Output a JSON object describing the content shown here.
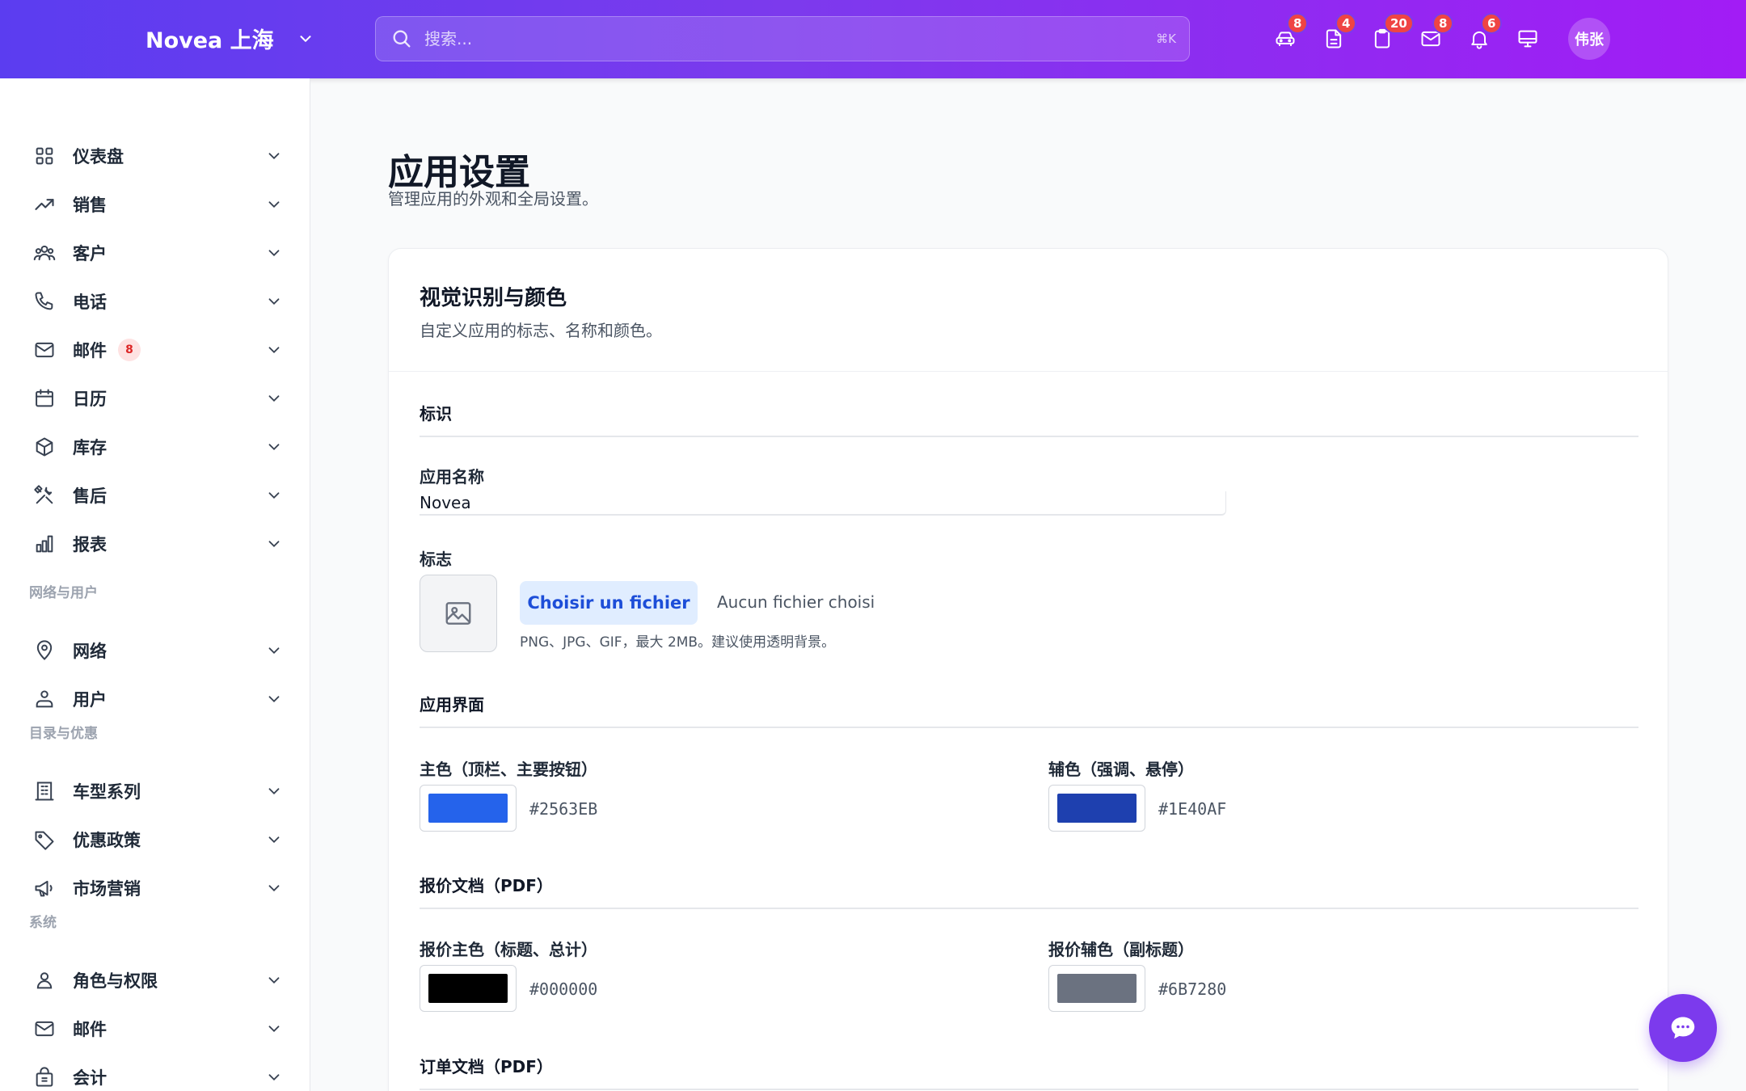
{
  "header": {
    "brand": "Novea 上海",
    "search_placeholder": "搜索...",
    "search_shortcut": "⌘K",
    "icons": [
      {
        "name": "car-icon",
        "badge": "8"
      },
      {
        "name": "document-icon",
        "badge": "4"
      },
      {
        "name": "clipboard-icon",
        "badge": "20"
      },
      {
        "name": "mail-icon",
        "badge": "8"
      },
      {
        "name": "bell-icon",
        "badge": "6"
      },
      {
        "name": "monitor-icon",
        "badge": ""
      }
    ],
    "avatar": "伟张"
  },
  "sidebar": {
    "items": [
      {
        "label": "仪表盘",
        "icon": "dashboard-icon"
      },
      {
        "label": "销售",
        "icon": "trend-icon"
      },
      {
        "label": "客户",
        "icon": "users-icon"
      },
      {
        "label": "电话",
        "icon": "phone-icon"
      },
      {
        "label": "邮件",
        "icon": "mail-icon",
        "badge": "8"
      },
      {
        "label": "日历",
        "icon": "calendar-icon"
      },
      {
        "label": "库存",
        "icon": "box-icon"
      },
      {
        "label": "售后",
        "icon": "tools-icon"
      },
      {
        "label": "报表",
        "icon": "chart-icon"
      }
    ],
    "section_network": "网络与用户",
    "network_items": [
      {
        "label": "网络",
        "icon": "location-icon"
      },
      {
        "label": "用户",
        "icon": "user-icon"
      }
    ],
    "section_catalog": "目录与优惠",
    "catalog_items": [
      {
        "label": "车型系列",
        "icon": "building-icon"
      },
      {
        "label": "优惠政策",
        "icon": "tag-icon"
      },
      {
        "label": "市场营销",
        "icon": "megaphone-icon"
      }
    ],
    "section_system": "系统",
    "system_items": [
      {
        "label": "角色与权限",
        "icon": "person-icon"
      },
      {
        "label": "邮件",
        "icon": "mail-icon"
      },
      {
        "label": "会计",
        "icon": "bag-icon"
      }
    ]
  },
  "page": {
    "title": "应用设置",
    "subtitle": "管理应用的外观和全局设置。"
  },
  "card": {
    "title": "视觉识别与颜色",
    "description": "自定义应用的标志、名称和颜色。",
    "group_identity": "标识",
    "app_name_label": "应用名称",
    "app_name_value": "Novea",
    "logo_label": "标志",
    "file_button": "Choisir un fichier",
    "file_status": "Aucun fichier choisi",
    "file_hint": "PNG、JPG、GIF，最大 2MB。建议使用透明背景。",
    "group_interface": "应用界面",
    "primary_label": "主色（顶栏、主要按钮）",
    "primary_hex": "#2563EB",
    "secondary_label": "辅色（强调、悬停）",
    "secondary_hex": "#1E40AF",
    "group_quote": "报价文档（PDF）",
    "quote_primary_label": "报价主色（标题、总计）",
    "quote_primary_hex": "#000000",
    "quote_secondary_label": "报价辅色（副标题）",
    "quote_secondary_hex": "#6B7280",
    "group_order": "订单文档（PDF）"
  },
  "colors": {
    "accent": "#7c3aed",
    "badge": "#ef4444"
  }
}
